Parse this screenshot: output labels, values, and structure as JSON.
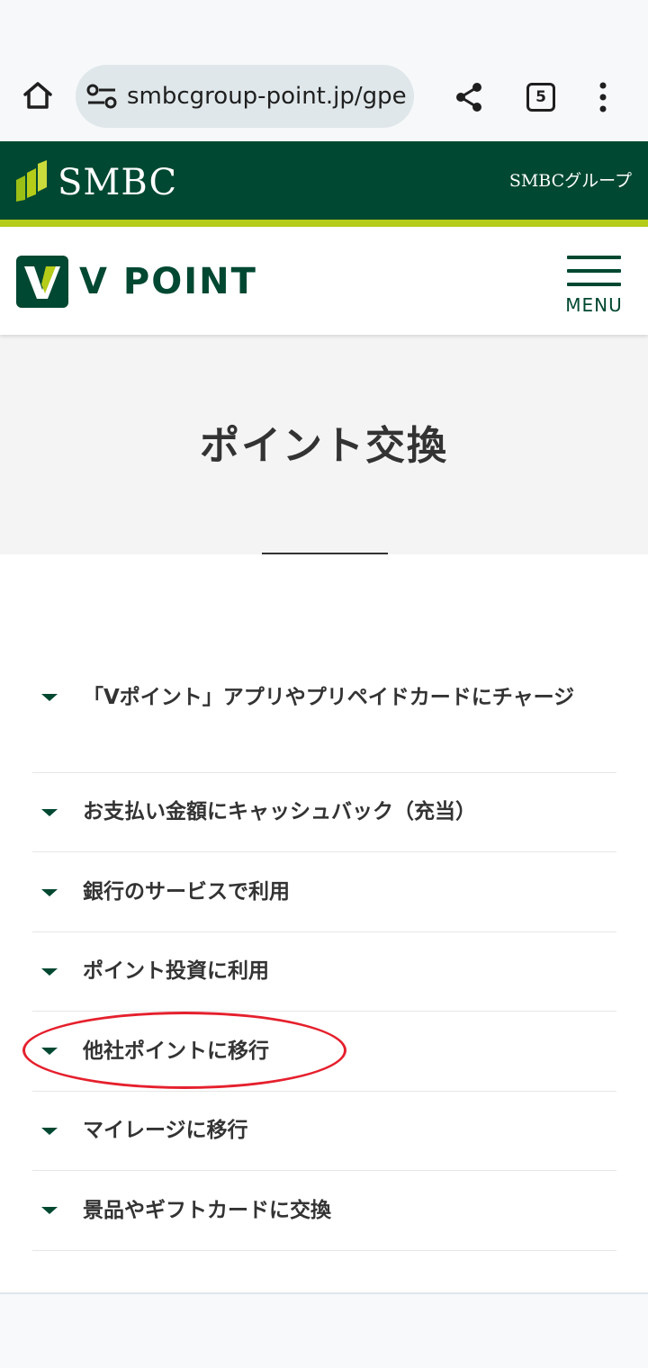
{
  "browser": {
    "url": "smbcgroup-point.jp/gpe/",
    "tab_count": "5",
    "icons": [
      "home-icon",
      "tune-icon",
      "share-icon",
      "tabs-icon",
      "more-vert-icon"
    ]
  },
  "smbc_header": {
    "brand": "SMBC",
    "group_label": "SMBCグループ",
    "colors": {
      "background": "#004831",
      "stripe": "#b5cc18"
    }
  },
  "vpoint_header": {
    "logo_letter": "V",
    "brand": "V POINT",
    "menu_label": "MENU"
  },
  "page": {
    "title": "ポイント交換"
  },
  "nav": {
    "items": [
      {
        "label": "「Vポイント」アプリやプリペイドカードにチャージ"
      },
      {
        "label": "お支払い金額にキャッシュバック（充当）"
      },
      {
        "label": "銀行のサービスで利用"
      },
      {
        "label": "ポイント投資に利用"
      },
      {
        "label": "他社ポイントに移行"
      },
      {
        "label": "マイレージに移行"
      },
      {
        "label": "景品やギフトカードに交換"
      }
    ]
  },
  "annotation": {
    "type": "red-ellipse",
    "target": "他社ポイントに移行",
    "color": "#e5202d"
  }
}
